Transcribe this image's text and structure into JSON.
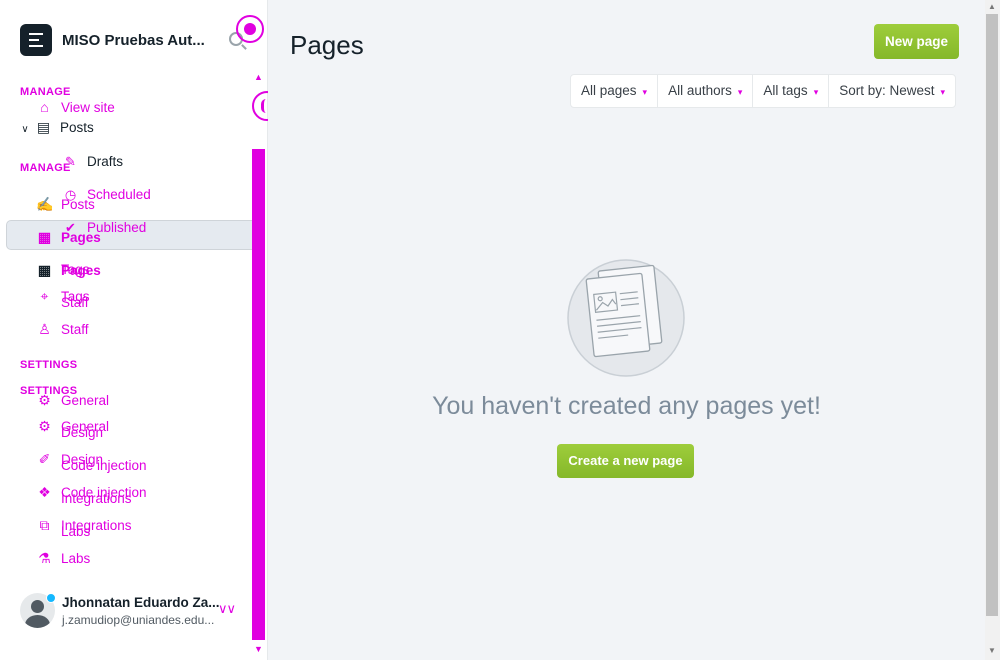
{
  "sidebar": {
    "site_title": "MISO Pruebas Aut...",
    "manage_label_1": "MANAGE",
    "manage_label_2": "MANAGE",
    "settings_label_1": "SETTINGS",
    "settings_label_2": "SETTINGS",
    "overlay_items": [
      {
        "label": "View site",
        "icon": "home-icon"
      },
      {
        "label": "Posts",
        "icon": "posts-icon"
      },
      {
        "label": "Drafts",
        "icon": "pencil-icon"
      },
      {
        "label": "Scheduled",
        "icon": "clock-icon"
      },
      {
        "label": "Published",
        "icon": "published-icon"
      },
      {
        "label": "Posts",
        "icon": "posts-icon"
      },
      {
        "label": "Pages",
        "icon": "pages-icon"
      },
      {
        "label": "Tags",
        "icon": "tag-icon"
      },
      {
        "label": "Staff",
        "icon": "staff-icon"
      },
      {
        "label": "General",
        "icon": "gear-icon"
      },
      {
        "label": "Design",
        "icon": "brush-icon"
      },
      {
        "label": "Code injection",
        "icon": "code-icon"
      },
      {
        "label": "Integrations",
        "icon": "integrations-icon"
      },
      {
        "label": "Labs",
        "icon": "flask-icon"
      }
    ],
    "items": [
      {
        "label": "Pages",
        "icon": "pages-icon"
      },
      {
        "label": "Tags",
        "icon": "tag-icon"
      },
      {
        "label": "Staff",
        "icon": "staff-icon"
      },
      {
        "label": "General",
        "icon": "gear-icon"
      },
      {
        "label": "Design",
        "icon": "brush-icon"
      },
      {
        "label": "Code injection",
        "icon": "code-icon"
      },
      {
        "label": "Integrations",
        "icon": "integrations-icon"
      },
      {
        "label": "Labs",
        "icon": "flask-icon"
      }
    ],
    "user": {
      "name": "Jhonnatan Eduardo Za...",
      "email": "j.zamudiop@uniandes.edu..."
    }
  },
  "main": {
    "title": "Pages",
    "new_page_button": "New page",
    "filters": [
      "All pages",
      "All authors",
      "All tags",
      "Sort by: Newest"
    ],
    "empty_message": "You haven't created any pages yet!",
    "create_button": "Create a new page"
  },
  "colors": {
    "accent_green": "#9ecd3b",
    "overlay_magenta": "#e000e0",
    "sidebar_dark": "#15212a",
    "main_bg": "#f2f4f7"
  }
}
